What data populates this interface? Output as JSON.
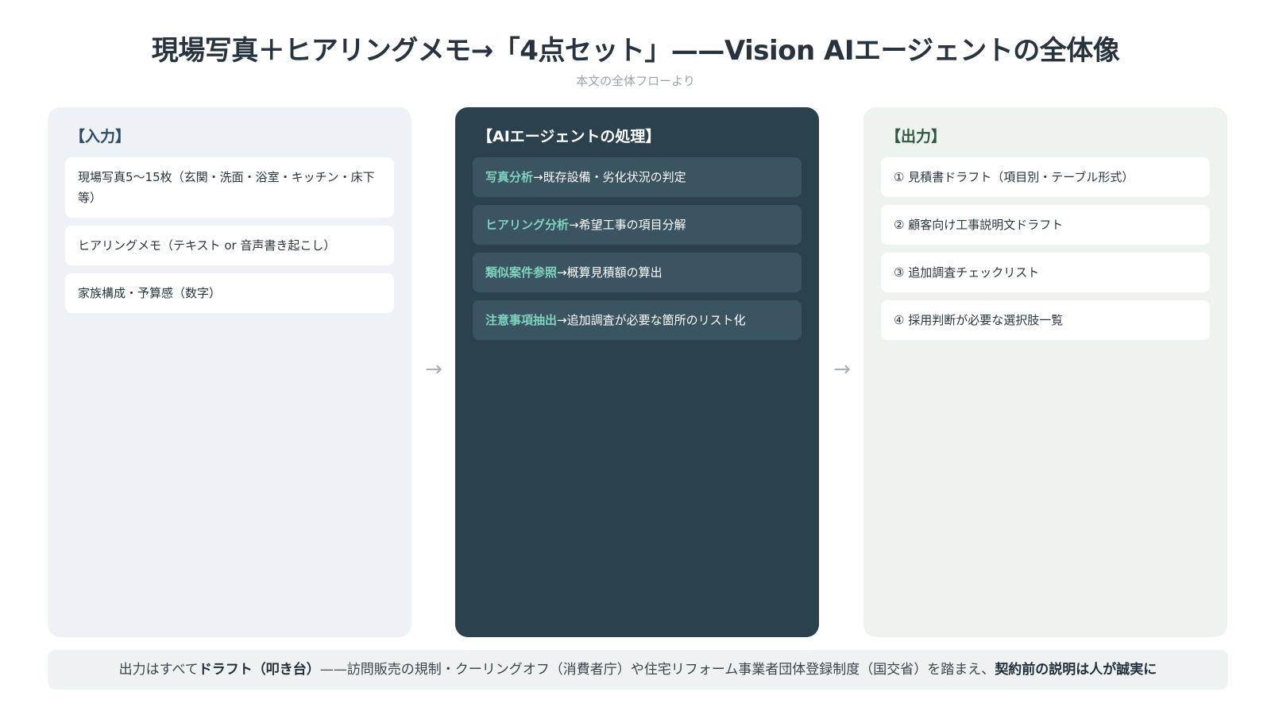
{
  "title": "現場写真＋ヒアリングメモ→「4点セット」——Vision AIエージェントの全体像",
  "subtitle": "本文の全体フローより",
  "input_panel": {
    "heading": "【入力】",
    "items": [
      "現場写真5〜15枚（玄関・洗面・浴室・キッチン・床下 等）",
      "ヒアリングメモ（テキスト or 音声書き起こし）",
      "家族構成・予算感（数字）"
    ]
  },
  "ai_panel": {
    "heading": "【AIエージェントの処理】",
    "items": [
      {
        "label": "写真分析",
        "text": "→既存設備・劣化状況の判定"
      },
      {
        "label": "ヒアリング分析",
        "text": "→希望工事の項目分解"
      },
      {
        "label": "類似案件参照",
        "text": "→概算見積額の算出"
      },
      {
        "label": "注意事項抽出",
        "text": "→追加調査が必要な箇所のリスト化"
      }
    ]
  },
  "output_panel": {
    "heading": "【出力】",
    "items": [
      "① 見積書ドラフト（項目別・テーブル形式）",
      "② 顧客向け工事説明文ドラフト",
      "③ 追加調査チェックリスト",
      "④ 採用判断が必要な選択肢一覧"
    ]
  },
  "arrows": {
    "symbol": "→"
  },
  "footer": {
    "prefix": "出力はすべて",
    "bold1": "ドラフト（叩き台）",
    "middle": "——訪問販売の規制・クーリングオフ（消費者庁）や住宅リフォーム事業者団体登録制度（国交省）を踏まえ、",
    "bold2": "契約前の説明は人が誠実に"
  },
  "colors": {
    "input_bg": "#eef1f5",
    "ai_bg": "#2b414e",
    "output_bg": "#eef3ef",
    "accent_green": "#7fd3bf"
  }
}
